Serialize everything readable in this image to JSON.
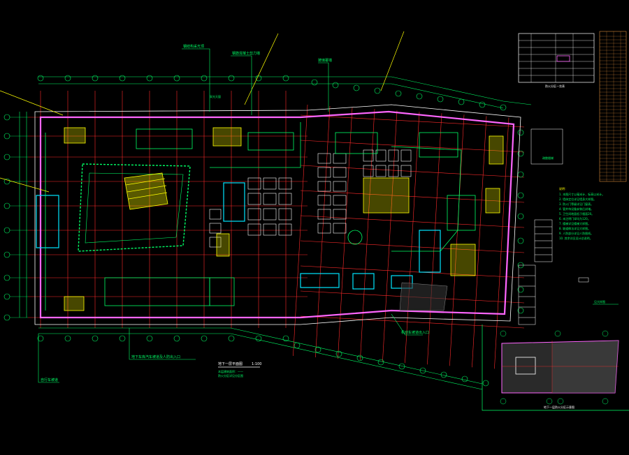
{
  "drawing": {
    "background": "#000000",
    "colors": {
      "grid": "#ff2b2b",
      "wall": "#00ff66",
      "core": "#ffff00",
      "outline": "#ff66ff",
      "cyan": "#00e5ff",
      "white": "#ffffff",
      "dim": "#cccccc"
    },
    "plan_title": "地下一层平面图",
    "plan_scale": "1:100",
    "plan_notes": [
      "本层建筑面积：——",
      "防火分区详见分区图"
    ],
    "leader_labels": [
      "钢结构采光顶",
      "钢筋混凝土剪力墙",
      "玻璃幕墙",
      "采光天窗",
      "机动车坡道出入口",
      "地下车库汽车坡道及人防出入口",
      "自行车坡道",
      "疏散楼梯"
    ],
    "keyplan_title": "地下一层防火分区示意图",
    "legend_title": "防火分区一览表",
    "general_notes_title": "说明：",
    "general_notes": [
      "1. 本图尺寸以毫米计，标高以米计。",
      "2. 墙体定位详见墙身大样图。",
      "3. 防火门等级详见门窗表。",
      "4. 管井待设备安装后封堵。",
      "5. 卫生间地面低于楼面20。",
      "6. 未注明门垛均为120。",
      "7. 楼梯详见楼梯大样图。",
      "8. 坡道做法详见大样图。",
      "9. 人防部分详见人防图纸。",
      "10. 其余详见设计总说明。"
    ],
    "section_note": "见大样图",
    "axis_numbers_top": [
      "1",
      "2",
      "3",
      "4",
      "5",
      "6",
      "7",
      "8",
      "9",
      "10",
      "11",
      "12",
      "13",
      "14",
      "15",
      "16",
      "17",
      "18",
      "19",
      "20",
      "21",
      "22",
      "23",
      "24",
      "25",
      "26",
      "27",
      "28",
      "29",
      "30",
      "31",
      "32"
    ],
    "axis_letters_left": [
      "A",
      "B",
      "C",
      "D",
      "E",
      "F",
      "G",
      "H",
      "J",
      "K",
      "L",
      "M"
    ]
  }
}
